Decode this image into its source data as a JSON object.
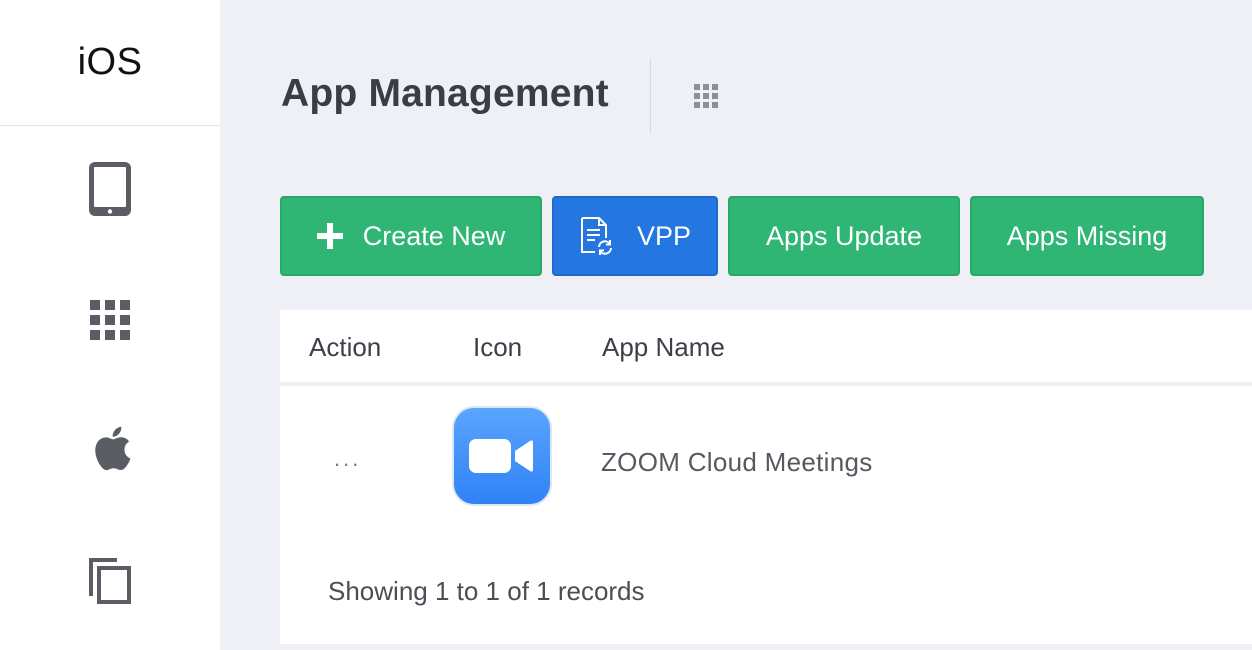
{
  "sidebar": {
    "title": "iOS",
    "items": [
      {
        "icon": "tablet-icon"
      },
      {
        "icon": "apps-grid-icon"
      },
      {
        "icon": "apple-icon"
      },
      {
        "icon": "copy-icon"
      }
    ]
  },
  "header": {
    "title": "App Management",
    "menu_icon": "grid-menu-icon"
  },
  "toolbar": {
    "create_new_label": "Create New",
    "vpp_label": "VPP",
    "apps_update_label": "Apps Update",
    "apps_missing_label": "Apps Missing"
  },
  "table": {
    "columns": [
      "Action",
      "Icon",
      "App Name"
    ],
    "rows": [
      {
        "action": "...",
        "icon": "zoom-app-icon",
        "app_name": "ZOOM Cloud Meetings"
      }
    ],
    "footer": "Showing 1 to 1 of 1 records"
  },
  "colors": {
    "green_button": "#2fb574",
    "blue_button": "#2476e0",
    "background": "#eef0f5"
  }
}
